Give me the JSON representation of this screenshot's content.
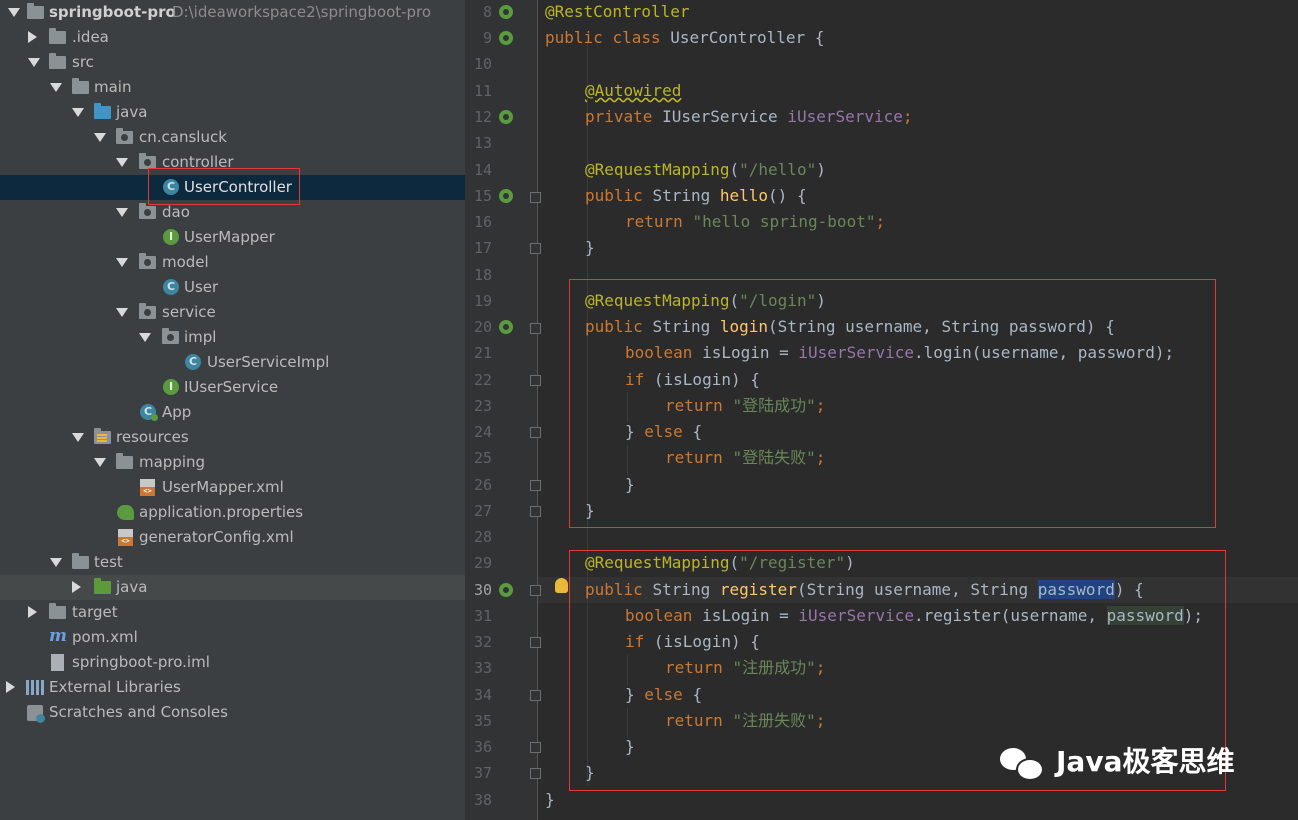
{
  "project": {
    "name": "springboot-pro",
    "path": "D:\\ideaworkspace2\\springboot-pro",
    "items": {
      "idea": ".idea",
      "src": "src",
      "main": "main",
      "java": "java",
      "package": "cn.cansluck",
      "controller": "controller",
      "user_controller": "UserController",
      "dao": "dao",
      "user_mapper": "UserMapper",
      "model": "model",
      "user": "User",
      "service": "service",
      "impl": "impl",
      "user_service_impl": "UserServiceImpl",
      "iuser_service": "IUserService",
      "app": "App",
      "resources": "resources",
      "mapping": "mapping",
      "user_mapper_xml": "UserMapper.xml",
      "app_properties": "application.properties",
      "generator_config": "generatorConfig.xml",
      "test": "test",
      "test_java": "java",
      "target": "target",
      "pom": "pom.xml",
      "iml": "springboot-pro.iml",
      "external_libraries": "External Libraries",
      "scratches": "Scratches and Consoles"
    }
  },
  "editor": {
    "line_numbers": [
      "8",
      "9",
      "10",
      "11",
      "12",
      "13",
      "14",
      "15",
      "16",
      "17",
      "18",
      "19",
      "20",
      "21",
      "22",
      "23",
      "24",
      "25",
      "26",
      "27",
      "28",
      "29",
      "30",
      "31",
      "32",
      "33",
      "34",
      "35",
      "36",
      "37",
      "38"
    ],
    "current_line": "30",
    "tokens": {
      "rest_controller": "@RestController",
      "public": "public",
      "class": "class",
      "class_name": "UserController {",
      "autowired": "@Autowired",
      "private": "private",
      "iuser_service_type": "IUserService",
      "iuser_service_field": "iUserService",
      "semicolon": ";",
      "request_mapping": "@RequestMapping",
      "hello_path": "\"/hello\"",
      "login_path": "\"/login\"",
      "register_path": "\"/register\"",
      "string": "String",
      "hello": "hello",
      "empty_params": "() {",
      "return": "return",
      "hello_str": "\"hello spring-boot\"",
      "close_brace": "}",
      "login": "login",
      "register": "register",
      "params_login": "(String username, String password) {",
      "params_register_a": "(String username, String ",
      "password": "password",
      "params_register_b": ") {",
      "boolean": "boolean",
      "is_login_assign": " isLogin = ",
      "call_login": ".login(username, password);",
      "call_register_a": ".register(username, ",
      "call_register_b": ");",
      "if": "if",
      "if_cond": " (isLogin) {",
      "else": "else",
      "login_ok": "\"登陆成功\"",
      "login_fail": "\"登陆失败\"",
      "register_ok": "\"注册成功\"",
      "register_fail": "\"注册失败\"",
      "paren_open": "(",
      "paren_close": ")"
    }
  },
  "watermark": {
    "text": "Java极客思维"
  },
  "colors": {
    "tree_bg": "#3c3f41",
    "editor_bg": "#2b2b2b",
    "selection": "#0d293e",
    "annotation_box": "#e53935",
    "keyword": "#cc7832",
    "annotation": "#bbb529",
    "string": "#6a8759",
    "field": "#9876aa",
    "method": "#ffc66d"
  }
}
